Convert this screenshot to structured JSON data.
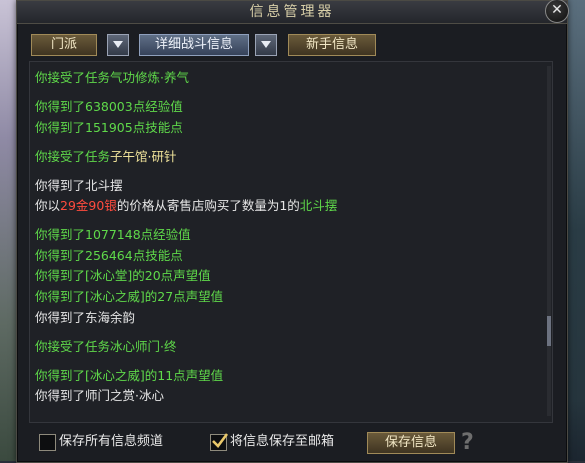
{
  "window": {
    "title": "信息管理器",
    "close_symbol": "✕"
  },
  "toolbar": {
    "faction_label": "门派",
    "detail_label": "详细战斗信息",
    "newbie_label": "新手信息"
  },
  "log": [
    [
      {
        "t": "你接受了任务气功修炼·养气",
        "c": "green"
      }
    ],
    [
      {
        "t": "你得到了638003点经验值",
        "c": "green"
      }
    ],
    [
      {
        "t": "你得到了151905点技能点",
        "c": "green"
      }
    ],
    [
      {
        "t": "你接受了任务",
        "c": "green"
      },
      {
        "t": "子午馆·研针",
        "c": "yellow"
      }
    ],
    [
      {
        "t": "你得到了北斗摆",
        "c": "white"
      }
    ],
    [
      {
        "t": "你以",
        "c": "white"
      },
      {
        "t": "29金90银",
        "c": "red"
      },
      {
        "t": "的价格从寄售店购买了数量为1的",
        "c": "white"
      },
      {
        "t": "北斗摆",
        "c": "green"
      }
    ],
    [
      {
        "t": "你得到了1077148点经验值",
        "c": "green"
      }
    ],
    [
      {
        "t": "你得到了256464点技能点",
        "c": "green"
      }
    ],
    [
      {
        "t": "你得到了[冰心堂]的20点声望值",
        "c": "green"
      }
    ],
    [
      {
        "t": "你得到了[冰心之威]的27点声望值",
        "c": "green"
      }
    ],
    [
      {
        "t": "你得到了东海余韵",
        "c": "white"
      }
    ],
    [
      {
        "t": "你接受了任务冰心师门·终",
        "c": "green"
      }
    ],
    [
      {
        "t": "你得到了[冰心之威]的11点声望值",
        "c": "green"
      }
    ],
    [
      {
        "t": "你得到了师门之赏·冰心",
        "c": "white"
      }
    ]
  ],
  "bottom": {
    "save_all_label": "保存所有信息频道",
    "save_all_checked": false,
    "save_mail_label": "将信息保存至邮箱",
    "save_mail_checked": true,
    "save_button_label": "保存信息",
    "help_symbol": "?"
  },
  "colors": {
    "green": "#5fd94a",
    "white": "#e6e6e6",
    "red": "#ff4b3e",
    "yellow": "#f0e39a"
  }
}
